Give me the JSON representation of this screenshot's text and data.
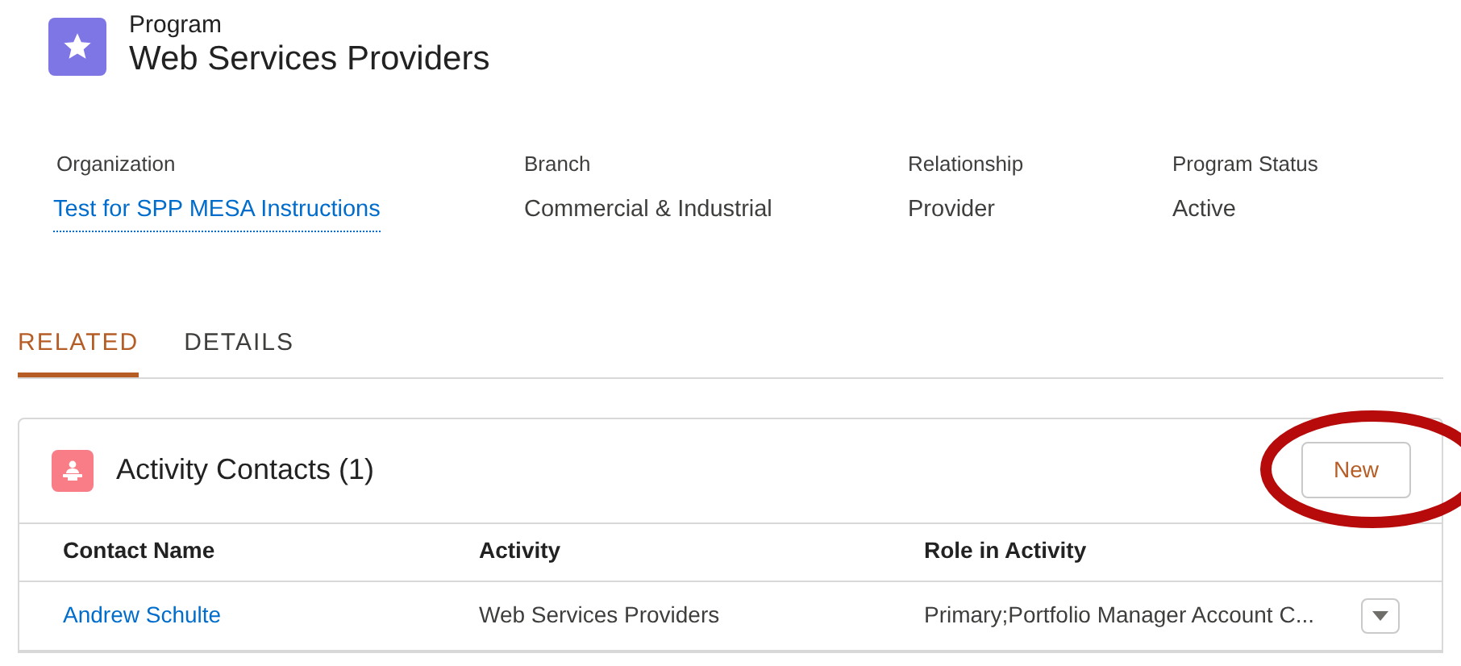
{
  "header": {
    "type_label": "Program",
    "title": "Web Services Providers"
  },
  "fields": [
    {
      "label": "Organization",
      "value": "Test for SPP MESA Instructions",
      "kind": "link"
    },
    {
      "label": "Branch",
      "value": "Commercial & Industrial",
      "kind": "text"
    },
    {
      "label": "Relationship",
      "value": "Provider",
      "kind": "text"
    },
    {
      "label": "Program Status",
      "value": "Active",
      "kind": "text"
    }
  ],
  "tabs": [
    {
      "label": "RELATED",
      "selected": true
    },
    {
      "label": "DETAILS",
      "selected": false
    }
  ],
  "card": {
    "title": "Activity Contacts (1)",
    "new_button": "New",
    "highlighted": true,
    "columns": [
      "Contact Name",
      "Activity",
      "Role in Activity"
    ],
    "rows": [
      {
        "contact": "Andrew Schulte",
        "activity": "Web Services Providers",
        "role": "Primary;Portfolio Manager Account C..."
      }
    ]
  }
}
